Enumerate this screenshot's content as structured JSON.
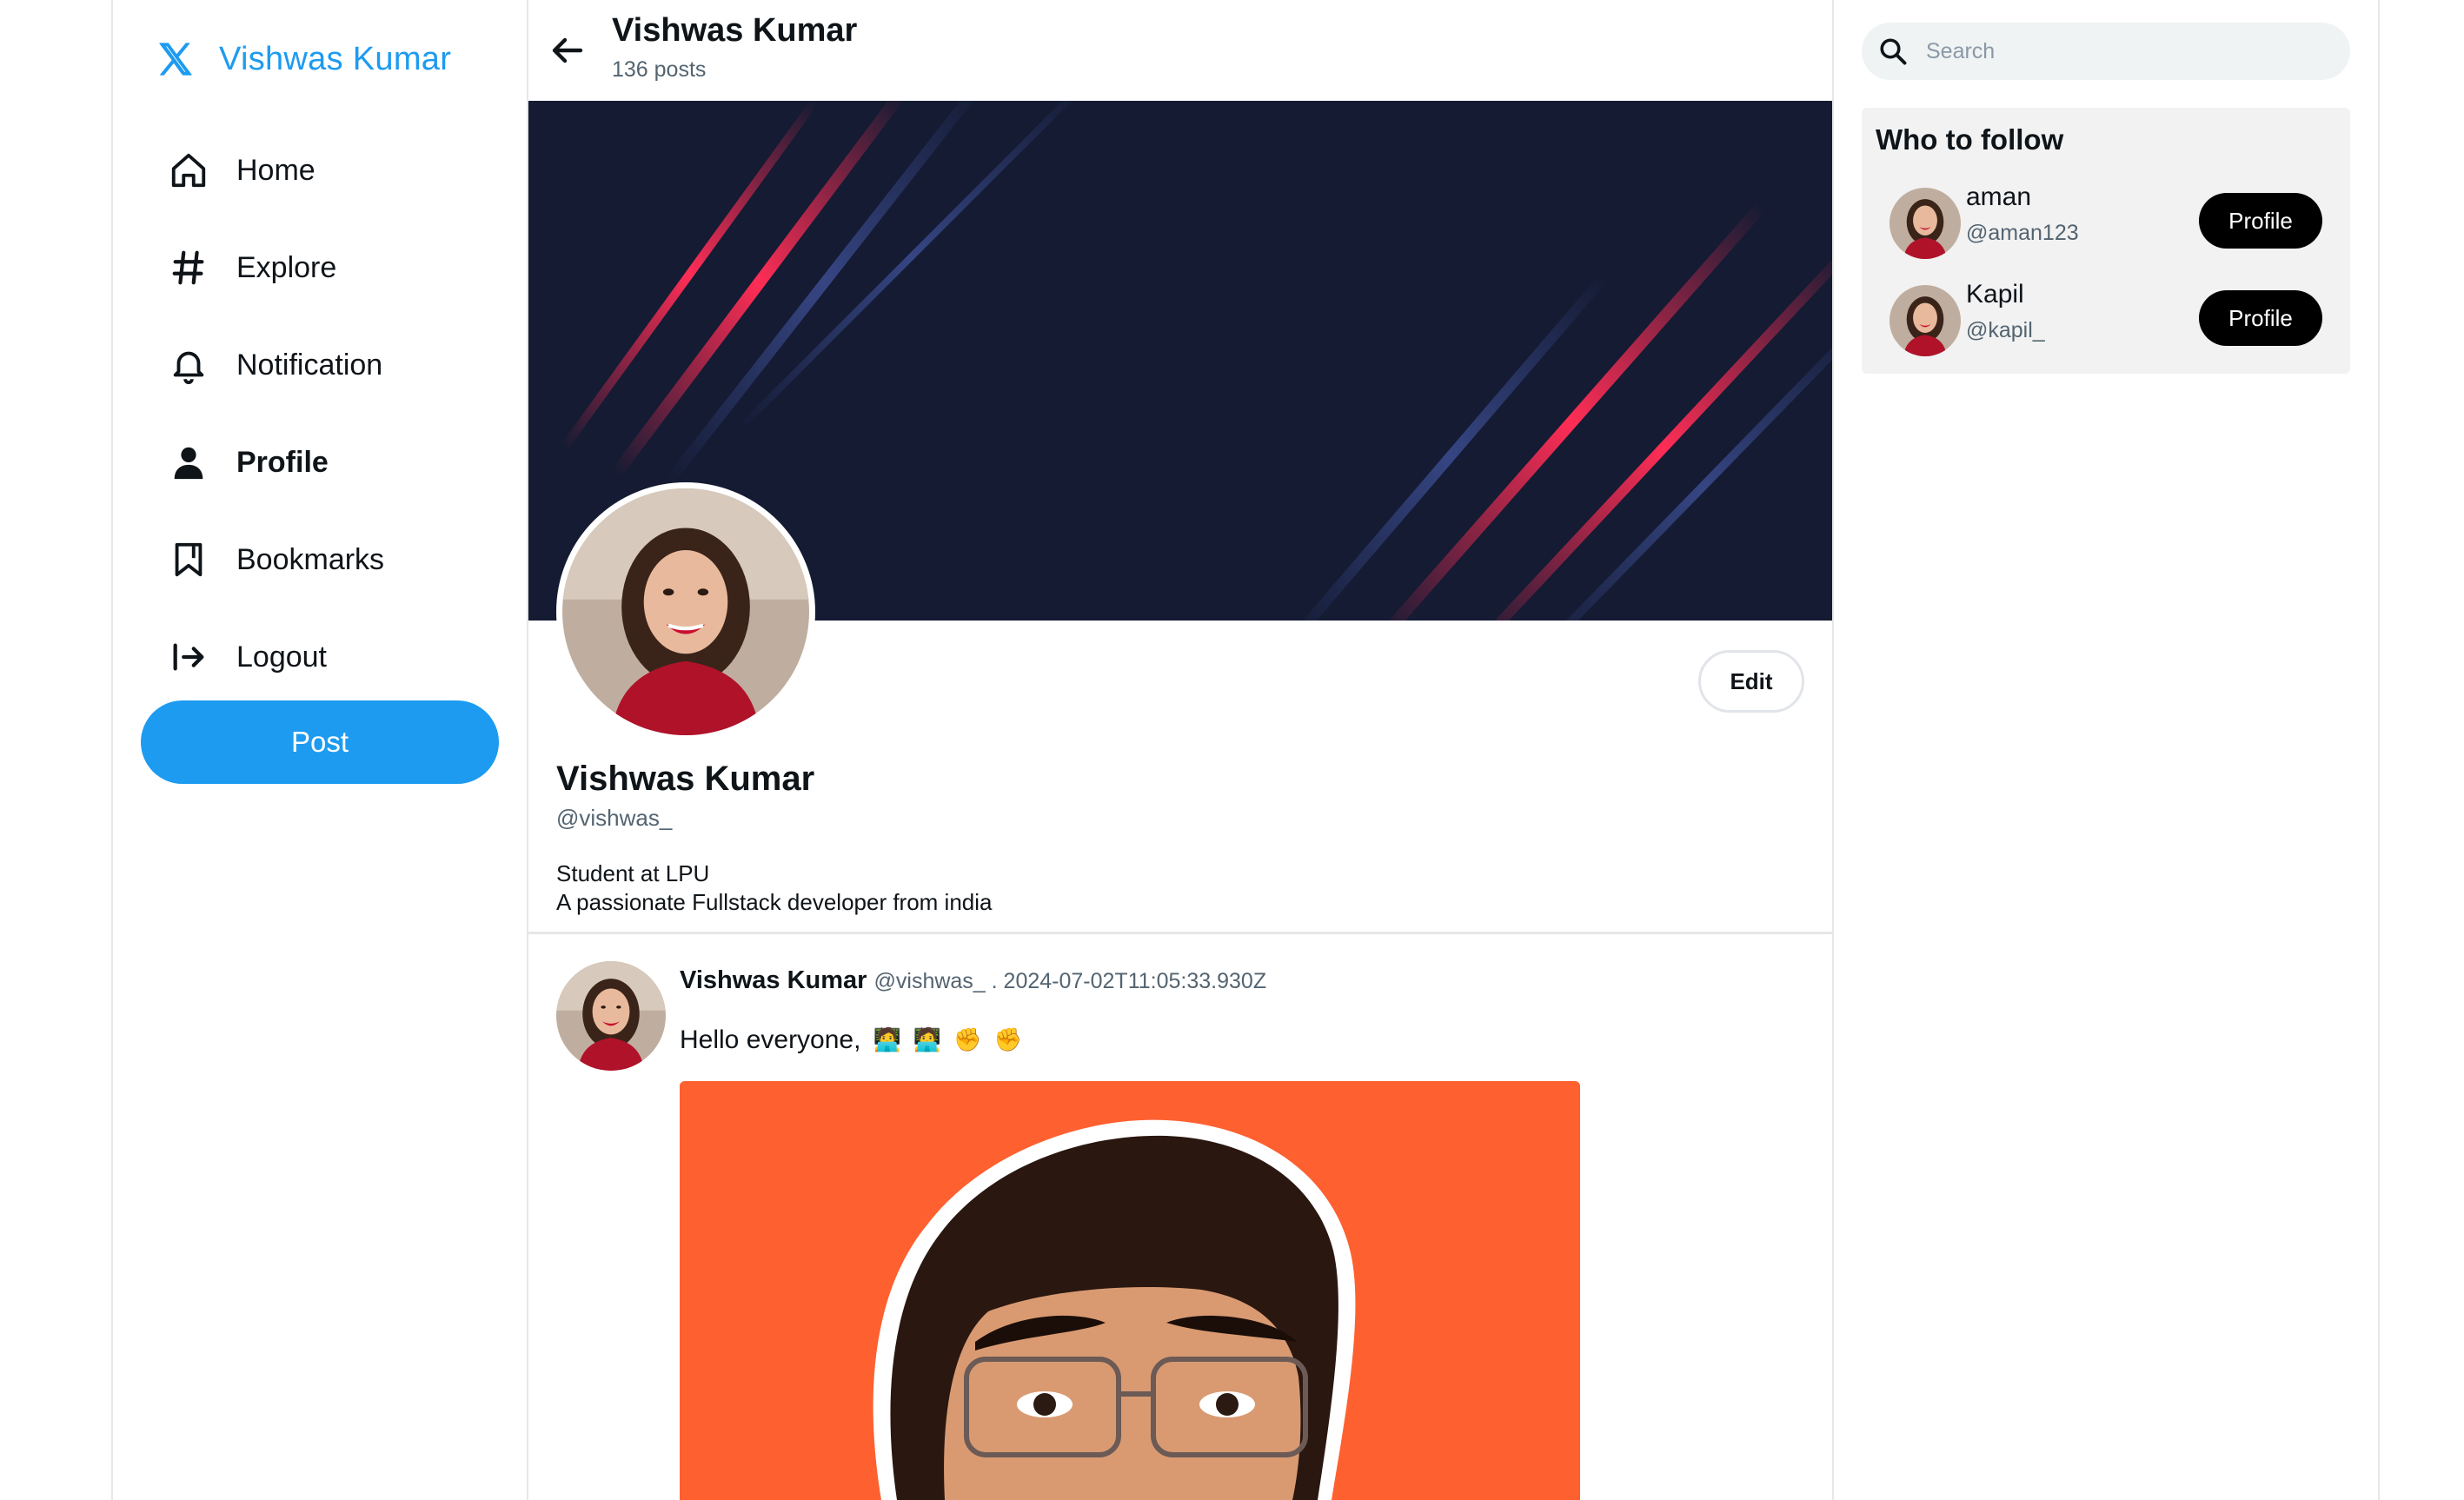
{
  "brand": {
    "title": "Vishwas Kumar",
    "icon": "x-logo-icon",
    "color": "#1d9bf0"
  },
  "nav": {
    "items": [
      {
        "label": "Home",
        "icon": "home-icon"
      },
      {
        "label": "Explore",
        "icon": "hashtag-icon"
      },
      {
        "label": "Notification",
        "icon": "bell-icon"
      },
      {
        "label": "Profile",
        "icon": "person-icon",
        "active": true
      },
      {
        "label": "Bookmarks",
        "icon": "bookmark-icon"
      },
      {
        "label": "Logout",
        "icon": "logout-icon"
      }
    ],
    "post_label": "Post"
  },
  "header": {
    "title": "Vishwas Kumar",
    "posts_count": "136 posts"
  },
  "profile": {
    "name": "Vishwas Kumar",
    "handle": "@vishwas_",
    "bio_line1": "Student at LPU",
    "bio_line2": "A passionate Fullstack developer from india",
    "edit_label": "Edit"
  },
  "tweet": {
    "author": "Vishwas Kumar",
    "meta": "@vishwas_ . 2024-07-02T11:05:33.930Z",
    "text": "Hello everyone,",
    "emojis": [
      "🧑‍💻",
      "🧑‍💻",
      "✊",
      "✊"
    ]
  },
  "search": {
    "placeholder": "Search"
  },
  "who_to_follow": {
    "title": "Who to follow",
    "users": [
      {
        "name": "aman",
        "handle": "@aman123",
        "button": "Profile"
      },
      {
        "name": "Kapil",
        "handle": "@kapil_",
        "button": "Profile"
      }
    ]
  },
  "colors": {
    "accent": "#1d9bf0",
    "banner": "#141b33",
    "tweet_image_bg": "#ff6030"
  }
}
